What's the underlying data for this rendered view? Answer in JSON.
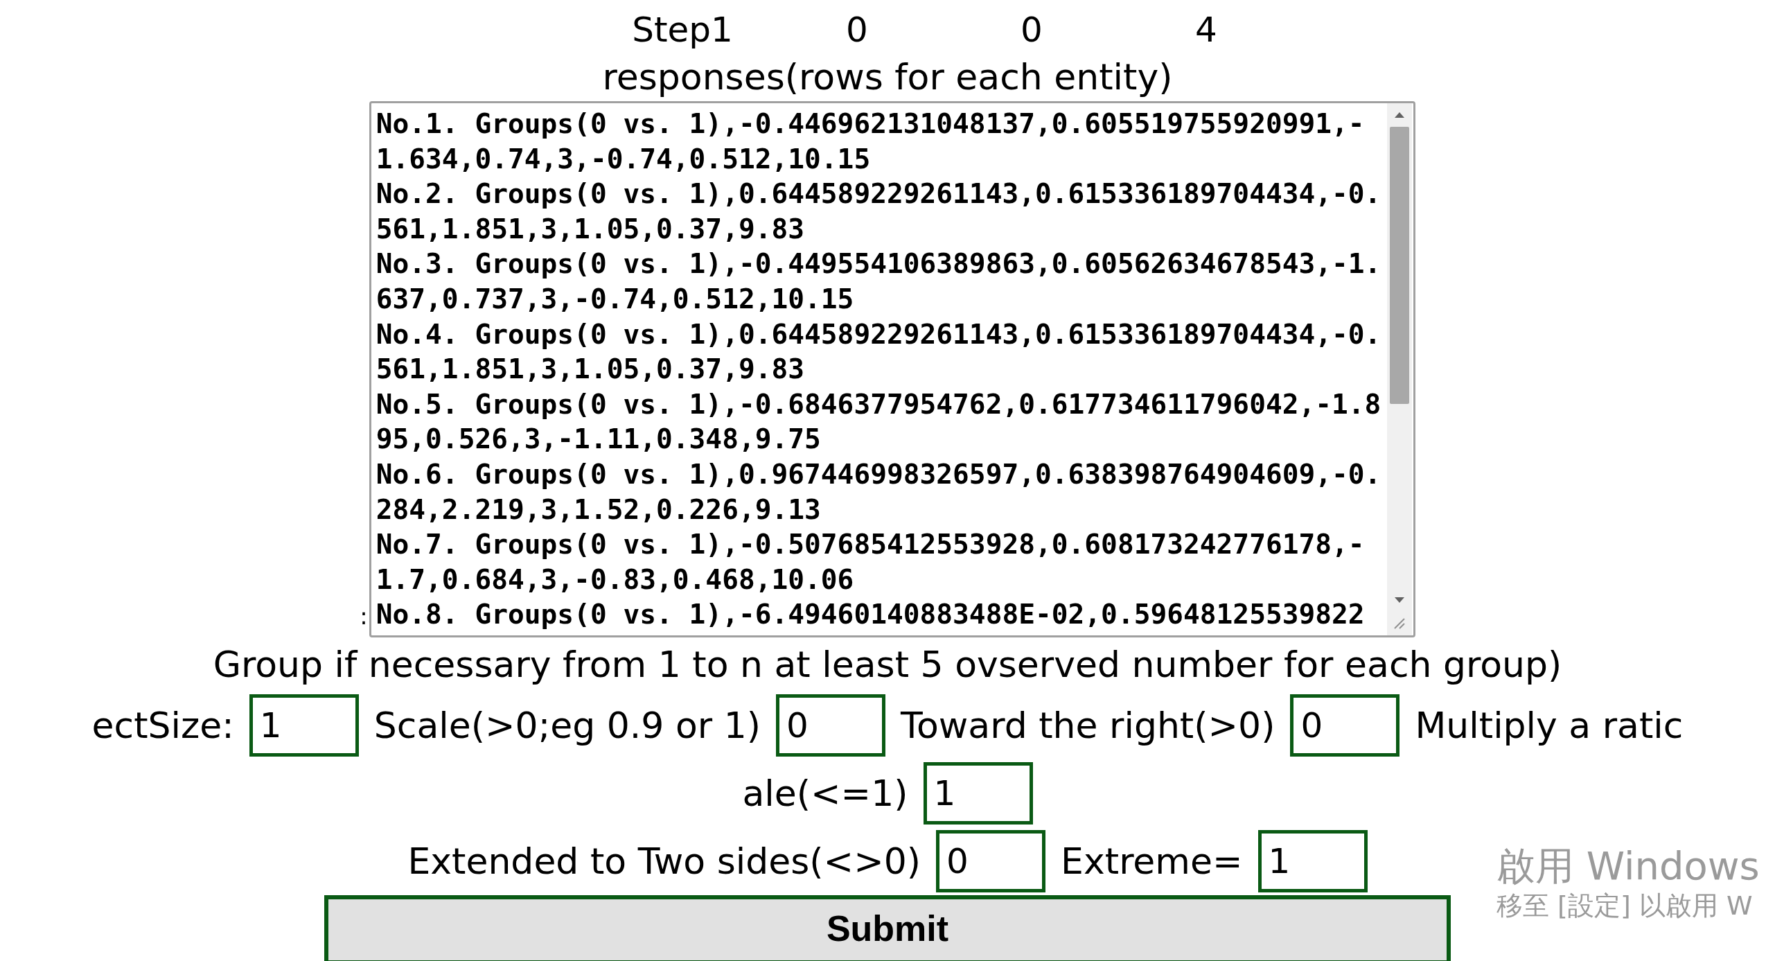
{
  "step_row": [
    "Step1",
    "0",
    "0",
    "4"
  ],
  "responses_label": "responses(rows for each entity)",
  "responses": {
    "rows": [
      "No.1. Groups(0 vs. 1),-0.446962131048137,0.605519755920991,-1.634,0.74,3,-0.74,0.512,10.15",
      "No.2. Groups(0 vs. 1),0.644589229261143,0.615336189704434,-0.561,1.851,3,1.05,0.37,9.83",
      "No.3. Groups(0 vs. 1),-0.449554106389863,0.60562634678543,-1.637,0.737,3,-0.74,0.512,10.15",
      "No.4. Groups(0 vs. 1),0.644589229261143,0.615336189704434,-0.561,1.851,3,1.05,0.37,9.83",
      "No.5. Groups(0 vs. 1),-0.6846377954762,0.617734611796042,-1.895,0.526,3,-1.11,0.348,9.75",
      "No.6. Groups(0 vs. 1),0.967446998326597,0.638398764904609,-0.284,2.219,3,1.52,0.226,9.13",
      "No.7. Groups(0 vs. 1),-0.507685412553928,0.608173242776178,-1.7,0.684,3,-0.83,0.468,10.06",
      "No.8. Groups(0 vs. 1),-6.49460140883488E-02,0.59648125539822"
    ]
  },
  "colon": ":",
  "group_note": "Group if necessary from 1 to n at least 5 ovserved number for each group)",
  "param_lines": [
    [
      {
        "kind": "text",
        "text": "ectSize:"
      },
      {
        "kind": "input",
        "value": "1"
      },
      {
        "kind": "text",
        "text": "Scale(>0;eg 0.9 or 1)"
      },
      {
        "kind": "input",
        "value": "0"
      },
      {
        "kind": "text",
        "text": "Toward the right(>0)"
      },
      {
        "kind": "input",
        "value": "0"
      },
      {
        "kind": "text",
        "text": "Multiply a ratic"
      }
    ],
    [
      {
        "kind": "text",
        "text": "ale(<=1)"
      },
      {
        "kind": "input",
        "value": "1"
      }
    ],
    [
      {
        "kind": "text",
        "text": "Extended to Two sides(<>0)"
      },
      {
        "kind": "input",
        "value": "0"
      },
      {
        "kind": "text",
        "text": "Extreme="
      },
      {
        "kind": "input",
        "value": "1"
      }
    ]
  ],
  "submit": "Submit",
  "os_notice": [
    "啟用 Windows",
    "移至 [設定] 以啟用 W"
  ]
}
